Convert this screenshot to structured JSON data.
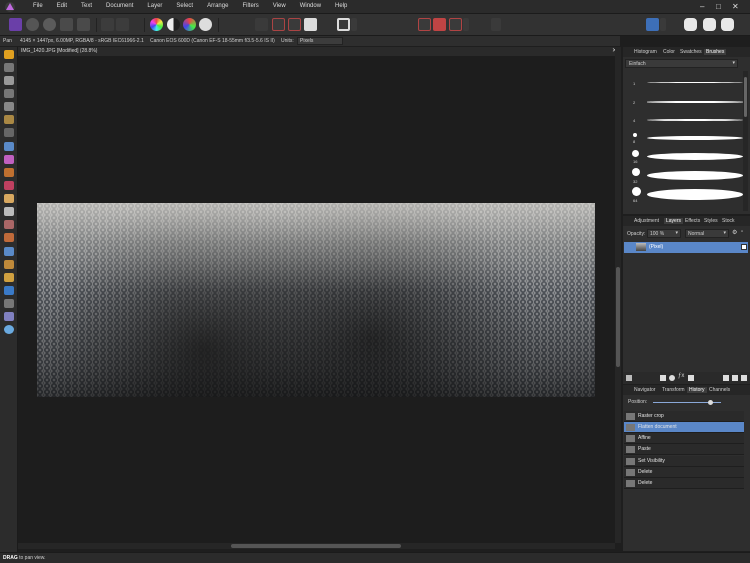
{
  "menubar": {
    "items": [
      "File",
      "Edit",
      "Text",
      "Document",
      "Layer",
      "Select",
      "Arrange",
      "Filters",
      "View",
      "Window",
      "Help"
    ],
    "controls": [
      "–",
      "□",
      "✕"
    ]
  },
  "context": {
    "tool_name": "Pan",
    "image_info": "4145 × 1447px, 6.00MP, RGBA/8 - sRGB IEC61966-2.1",
    "camera": "Canon EOS 600D (Canon EF-S 18-55mm f/3.5-5.6 IS II)",
    "units_label": "Units:",
    "units_value": "Pixels"
  },
  "document": {
    "tab_label": "IMG_1420.JPG [Modified] (28.8%)"
  },
  "status": {
    "bold": "DRAG",
    "text": " to pan view."
  },
  "brushes_panel": {
    "tabs": [
      "Histogram",
      "Color",
      "Swatches",
      "Brushes"
    ],
    "active_tab": "Brushes",
    "category": "Einfach",
    "brush_sizes": [
      "1",
      "2",
      "4",
      "8",
      "16",
      "32",
      "64"
    ]
  },
  "layers_panel": {
    "tabs": [
      "Adjustment",
      "Layers",
      "Effects",
      "Styles",
      "Stock"
    ],
    "active_tab": "Layers",
    "opacity_label": "Opacity:",
    "opacity_value": "100 %",
    "blend_mode": "Normal",
    "layers": [
      {
        "name": "(Pixel)",
        "visible": true
      }
    ]
  },
  "history_panel": {
    "tabs": [
      "Navigator",
      "Transform",
      "History",
      "Channels"
    ],
    "active_tab": "History",
    "position_label": "Position:",
    "position_fraction": 0.85,
    "items": [
      "Raster crop",
      "Flatten document",
      "Affine",
      "Paste",
      "Set Visibility",
      "Delete",
      "Delete"
    ],
    "selected_index": 1
  }
}
